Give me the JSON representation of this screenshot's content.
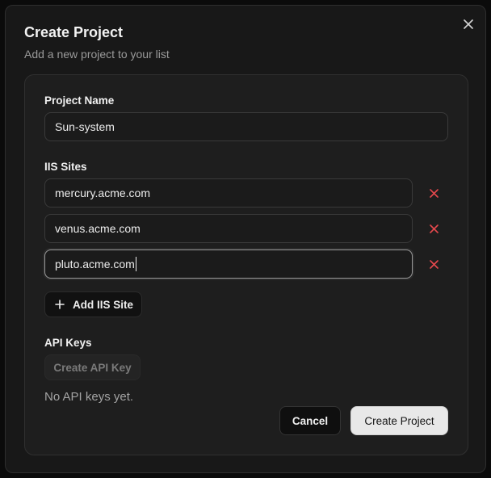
{
  "dialog": {
    "title": "Create Project",
    "subtitle": "Add a new project to your list"
  },
  "project_name": {
    "label": "Project Name",
    "value": "Sun-system"
  },
  "iis_sites": {
    "label": "IIS Sites",
    "items": [
      {
        "value": "mercury.acme.com"
      },
      {
        "value": "venus.acme.com"
      },
      {
        "value": "pluto.acme.com"
      }
    ],
    "add_label": "Add IIS Site"
  },
  "api_keys": {
    "label": "API Keys",
    "create_label": "Create API Key",
    "empty_text": "No API keys yet."
  },
  "footer": {
    "cancel_label": "Cancel",
    "submit_label": "Create Project"
  },
  "icons": {
    "close": "close-icon",
    "remove": "x-icon",
    "add": "plus-icon"
  },
  "colors": {
    "remove_accent": "#e5484d",
    "primary_button": "#e8e8e8"
  }
}
